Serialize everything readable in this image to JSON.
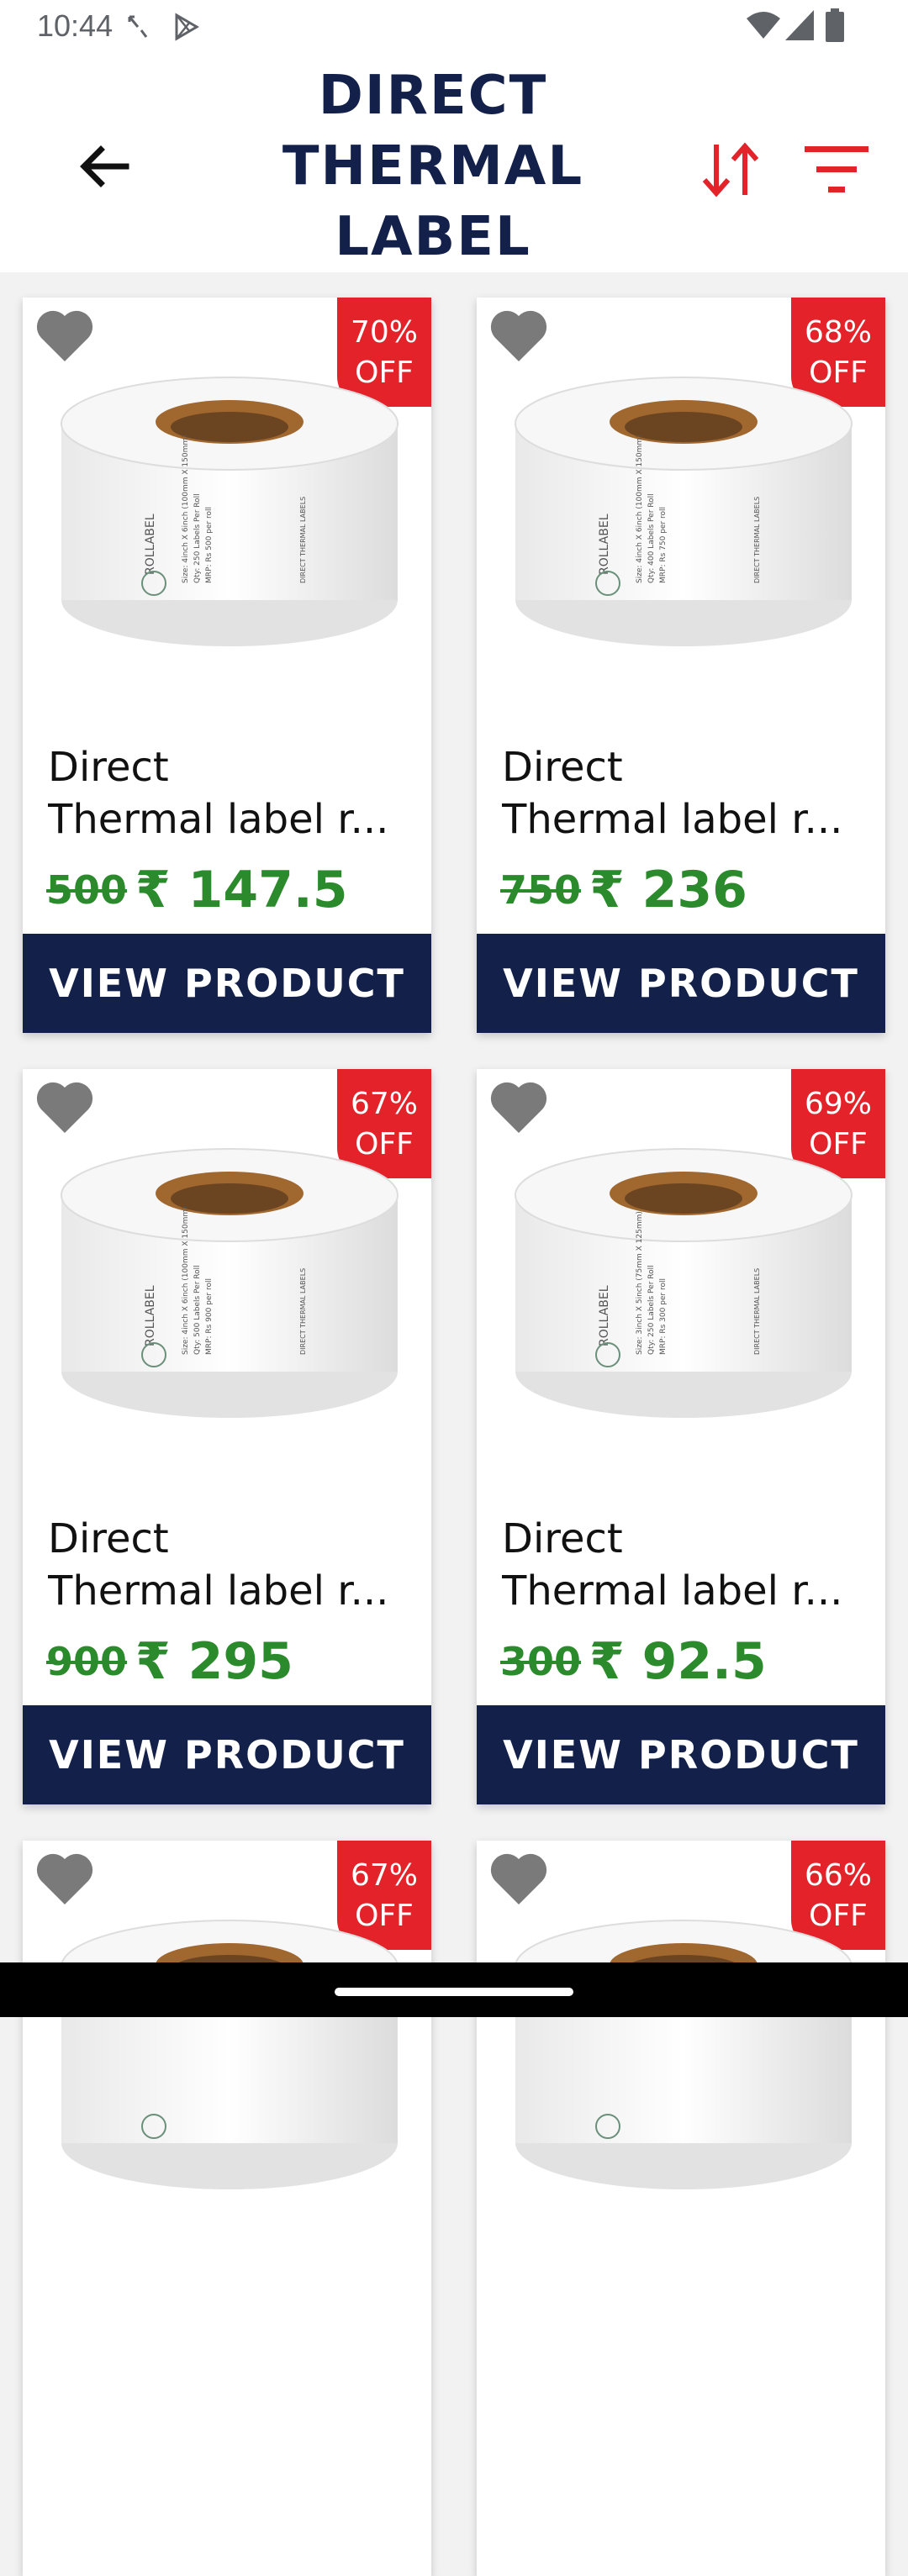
{
  "status_bar": {
    "time": "10:44",
    "icons": [
      "missed-call-icon",
      "play-store-icon",
      "wifi-icon",
      "signal-icon",
      "battery-icon"
    ]
  },
  "header": {
    "title_lines": [
      "DIRECT",
      "THERMAL",
      "LABEL"
    ],
    "icons": [
      "back-arrow-icon",
      "sort-icon",
      "filter-icon"
    ],
    "accent_color": "#e3222a",
    "title_color": "#13214a"
  },
  "products": [
    {
      "discount_line1": "70%",
      "discount_line2": "OFF",
      "name_line1": "Direct",
      "name_line2": "Thermal label  r...",
      "old_price": "500",
      "new_price": "₹ 147.5",
      "button": "VIEW PRODUCT",
      "label_text": {
        "brand": "ROLLABEL",
        "type": "DIRECT THERMAL LABELS",
        "size": "Size: 4inch X 6inch (100mm X 150mm)",
        "qty": "Qty: 250 Labels Per Roll",
        "mrp": "MRP: Rs 500 per roll"
      }
    },
    {
      "discount_line1": "68%",
      "discount_line2": "OFF",
      "name_line1": "Direct",
      "name_line2": "Thermal label  r...",
      "old_price": "750",
      "new_price": "₹ 236",
      "button": "VIEW PRODUCT",
      "label_text": {
        "brand": "ROLLABEL",
        "type": "DIRECT THERMAL LABELS",
        "size": "Size: 4inch X 6inch (100mm X 150mm)",
        "qty": "Qty: 400 Labels Per Roll",
        "mrp": "MRP: Rs 750 per roll"
      }
    },
    {
      "discount_line1": "67%",
      "discount_line2": "OFF",
      "name_line1": "Direct",
      "name_line2": "Thermal label  r...",
      "old_price": "900",
      "new_price": "₹ 295",
      "button": "VIEW PRODUCT",
      "label_text": {
        "brand": "ROLLABEL",
        "type": "DIRECT THERMAL LABELS",
        "size": "Size: 4inch X 6inch (100mm X 150mm)",
        "qty": "Qty: 500 Labels Per Roll",
        "mrp": "MRP: Rs 900 per roll"
      }
    },
    {
      "discount_line1": "69%",
      "discount_line2": "OFF",
      "name_line1": "Direct",
      "name_line2": "Thermal label  r...",
      "old_price": "300",
      "new_price": "₹ 92.5",
      "button": "VIEW PRODUCT",
      "label_text": {
        "brand": "ROLLABEL",
        "type": "DIRECT THERMAL LABELS",
        "size": "Size: 3inch X 5inch (75mm X 125mm)",
        "qty": "Qty: 250 Labels Per Roll",
        "mrp": "MRP: Rs 300 per roll"
      }
    },
    {
      "discount_line1": "67%",
      "discount_line2": "OFF"
    },
    {
      "discount_line1": "66%",
      "discount_line2": "OFF"
    }
  ]
}
